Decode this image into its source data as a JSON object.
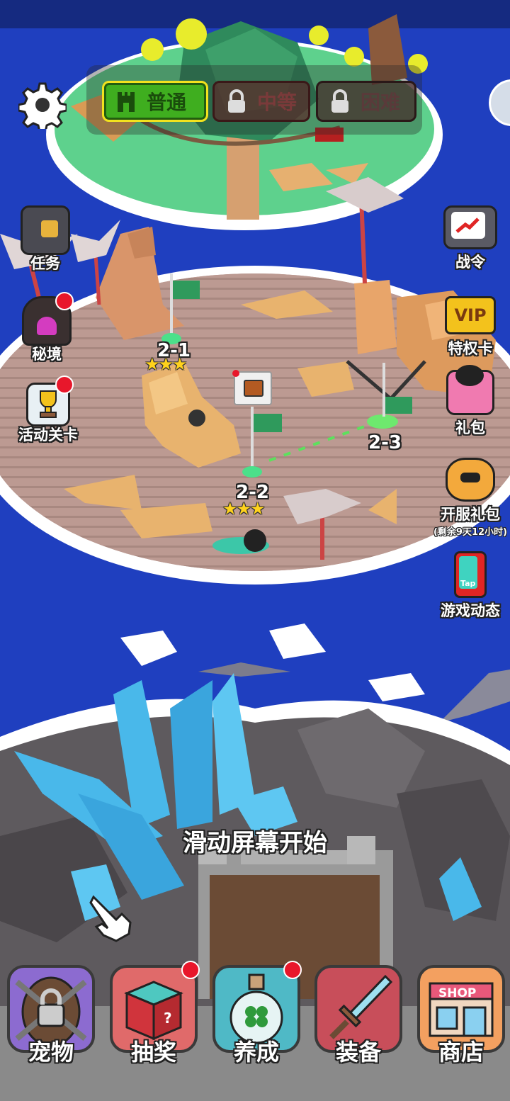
{
  "difficulty": {
    "tabs": [
      {
        "label": "普通",
        "locked": false,
        "active": true
      },
      {
        "label": "中等",
        "locked": true,
        "active": false
      },
      {
        "label": "困难",
        "locked": true,
        "active": false
      }
    ]
  },
  "left_menu": [
    {
      "label": "任务",
      "icon": "quest-book-icon",
      "badge": false
    },
    {
      "label": "秘境",
      "icon": "secret-cave-icon",
      "badge": true
    },
    {
      "label": "活动关卡",
      "icon": "trophy-icon",
      "badge": true
    }
  ],
  "right_menu": [
    {
      "label": "战令",
      "icon": "battle-pass-tv-icon"
    },
    {
      "label": "特权卡",
      "icon": "vip-card-icon",
      "badge_text": "VIP"
    },
    {
      "label": "礼包",
      "icon": "gift-pack-icon"
    },
    {
      "label": "开服礼包",
      "icon": "opening-gift-icon",
      "sub": "(剩余9天12小时)"
    },
    {
      "label": "游戏动态",
      "icon": "phone-tap-icon",
      "badge_text": "Tap"
    }
  ],
  "levels": [
    {
      "label": "2-1",
      "stars": "★★★"
    },
    {
      "label": "2-2",
      "stars": "★★★"
    },
    {
      "label": "2-3",
      "stars": ""
    }
  ],
  "hint": "滑动屏幕开始",
  "shop_sign": "SHOP",
  "bottom_nav": [
    {
      "label": "宠物",
      "icon": "locked-egg-icon",
      "badge": false
    },
    {
      "label": "抽奖",
      "icon": "lottery-box-icon",
      "badge": true
    },
    {
      "label": "养成",
      "icon": "clover-bottle-icon",
      "badge": true
    },
    {
      "label": "装备",
      "icon": "sword-icon",
      "badge": false
    },
    {
      "label": "商店",
      "icon": "shop-icon",
      "badge": false
    }
  ],
  "colors": {
    "ocean": "#1f3fbf",
    "badge": "#e8172b",
    "active_tab": "#3fae1f",
    "star": "#ffd21c"
  }
}
